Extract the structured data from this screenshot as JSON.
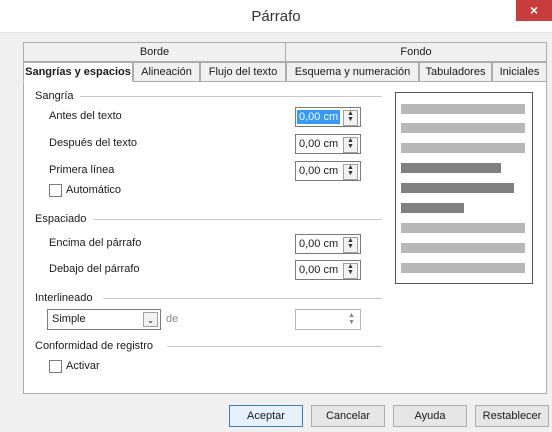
{
  "window": {
    "title": "Párrafo",
    "close_glyph": "×"
  },
  "tabs_top": [
    {
      "label": "Borde"
    },
    {
      "label": "Fondo"
    }
  ],
  "tabs": [
    {
      "label": "Sangrías y espacios",
      "active": true
    },
    {
      "label": "Alineación"
    },
    {
      "label": "Flujo del texto"
    },
    {
      "label": "Esquema y numeración"
    },
    {
      "label": "Tabuladores"
    },
    {
      "label": "Iniciales"
    }
  ],
  "indent": {
    "heading": "Sangría",
    "before": {
      "label": "Antes del texto",
      "value": "0,00 cm"
    },
    "after": {
      "label": "Después del texto",
      "value": "0,00 cm"
    },
    "first_line": {
      "label": "Primera línea",
      "value": "0,00 cm"
    },
    "automatic": {
      "label": "Automático",
      "checked": false
    }
  },
  "spacing": {
    "heading": "Espaciado",
    "above": {
      "label": "Encima del párrafo",
      "value": "0,00 cm"
    },
    "below": {
      "label": "Debajo del párrafo",
      "value": "0,00 cm"
    }
  },
  "line_spacing": {
    "heading": "Interlineado",
    "selected": "Simple",
    "of_label": "de",
    "value": ""
  },
  "register": {
    "heading": "Conformidad de registro",
    "activate": {
      "label": "Activar",
      "checked": false
    }
  },
  "buttons": {
    "accept": "Aceptar",
    "cancel": "Cancelar",
    "help": "Ayuda",
    "reset": "Restablecer"
  },
  "icons": {
    "spin": "spin-arrows-icon",
    "dropdown": "chevron-down-icon",
    "close": "close-icon"
  }
}
